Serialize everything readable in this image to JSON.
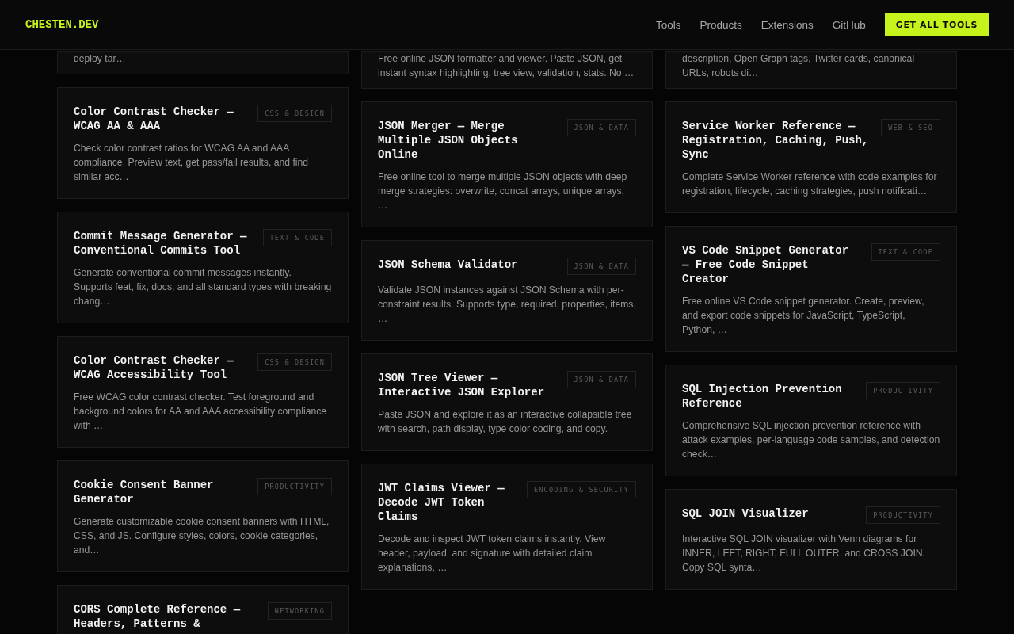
{
  "header": {
    "logo": "CHESTEN.DEV",
    "nav": [
      "Tools",
      "Products",
      "Extensions",
      "GitHub"
    ],
    "cta": "GET ALL TOOLS"
  },
  "columns": [
    {
      "cards": [
        {
          "description": "deploy tar…"
        },
        {
          "title": "Color Contrast Checker — WCAG AA & AAA",
          "tag": "CSS & DESIGN",
          "description": "Check color contrast ratios for WCAG AA and AAA compliance. Preview text, get pass/fail results, and find similar acc…"
        },
        {
          "title": "Commit Message Generator — Conventional Commits Tool",
          "tag": "TEXT & CODE",
          "description": "Generate conventional commit messages instantly. Supports feat, fix, docs, and all standard types with breaking chang…"
        },
        {
          "title": "Color Contrast Checker — WCAG Accessibility Tool",
          "tag": "CSS & DESIGN",
          "description": "Free WCAG color contrast checker. Test foreground and background colors for AA and AAA accessibility compliance with …"
        },
        {
          "title": "Cookie Consent Banner Generator",
          "tag": "PRODUCTIVITY",
          "description": "Generate customizable cookie consent banners with HTML, CSS, and JS. Configure styles, colors, cookie categories, and…"
        },
        {
          "title": "CORS Complete Reference — Headers, Patterns &",
          "tag": "NETWORKING"
        }
      ]
    },
    {
      "cards": [
        {
          "description": "Free online JSON formatter and viewer. Paste JSON, get instant syntax highlighting, tree view, validation, stats. No …"
        },
        {
          "title": "JSON Merger — Merge Multiple JSON Objects Online",
          "tag": "JSON & DATA",
          "description": "Free online tool to merge multiple JSON objects with deep merge strategies: overwrite, concat arrays, unique arrays, …"
        },
        {
          "title": "JSON Schema Validator",
          "tag": "JSON & DATA",
          "description": "Validate JSON instances against JSON Schema with per-constraint results. Supports type, required, properties, items, …"
        },
        {
          "title": "JSON Tree Viewer — Interactive JSON Explorer",
          "tag": "JSON & DATA",
          "description": "Paste JSON and explore it as an interactive collapsible tree with search, path display, type color coding, and copy."
        },
        {
          "title": "JWT Claims Viewer — Decode JWT Token Claims",
          "tag": "ENCODING & SECURITY",
          "description": "Decode and inspect JWT token claims instantly. View header, payload, and signature with detailed claim explanations, …"
        }
      ]
    },
    {
      "cards": [
        {
          "description": "description, Open Graph tags, Twitter cards, canonical URLs, robots di…"
        },
        {
          "title": "Service Worker Reference — Registration, Caching, Push, Sync",
          "tag": "WEB & SEO",
          "description": "Complete Service Worker reference with code examples for registration, lifecycle, caching strategies, push notificati…"
        },
        {
          "title": "VS Code Snippet Generator — Free Code Snippet Creator",
          "tag": "TEXT & CODE",
          "description": "Free online VS Code snippet generator. Create, preview, and export code snippets for JavaScript, TypeScript, Python, …"
        },
        {
          "title": "SQL Injection Prevention Reference",
          "tag": "PRODUCTIVITY",
          "description": "Comprehensive SQL injection prevention reference with attack examples, per-language code samples, and detection check…"
        },
        {
          "title": "SQL JOIN Visualizer",
          "tag": "PRODUCTIVITY",
          "description": "Interactive SQL JOIN visualizer with Venn diagrams for INNER, LEFT, RIGHT, FULL OUTER, and CROSS JOIN. Copy SQL synta…"
        }
      ]
    }
  ]
}
